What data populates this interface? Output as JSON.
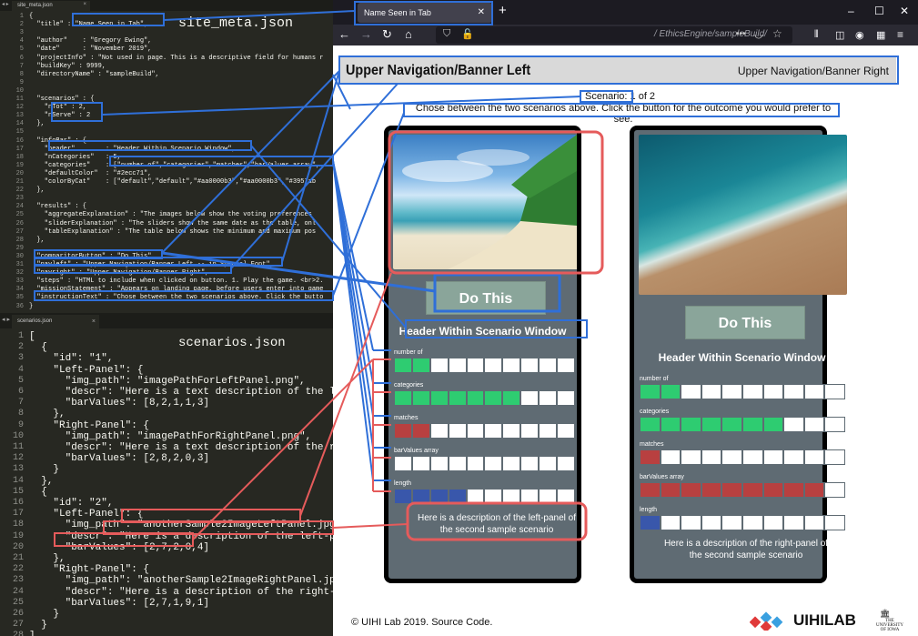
{
  "editor_top": {
    "tab_label": "site_meta.json",
    "heading": "site_meta.json",
    "lines": [
      {
        "n": "1",
        "t": "{"
      },
      {
        "n": "2",
        "t": "  \"title\" : \"Name Seen in Tab\","
      },
      {
        "n": "3",
        "t": ""
      },
      {
        "n": "4",
        "t": "  \"author\"    : \"Gregory Ewing\","
      },
      {
        "n": "5",
        "t": "  \"date\"      : \"November 2019\","
      },
      {
        "n": "6",
        "t": "  \"projectInfo\" : \"Not used in page. This is a descriptive field for humans r"
      },
      {
        "n": "7",
        "t": "  \"buildKey\" : 9999,"
      },
      {
        "n": "8",
        "t": "  \"directoryName\" : \"sampleBuild\","
      },
      {
        "n": "9",
        "t": ""
      },
      {
        "n": "10",
        "t": ""
      },
      {
        "n": "11",
        "t": "  \"scenarios\" : {"
      },
      {
        "n": "12",
        "t": "    \"nTot\" : 2,"
      },
      {
        "n": "13",
        "t": "    \"nServe\" : 2"
      },
      {
        "n": "14",
        "t": "  },"
      },
      {
        "n": "15",
        "t": ""
      },
      {
        "n": "16",
        "t": "  \"infoBar\" : {"
      },
      {
        "n": "17",
        "t": "    \"header\"        : \"Header Within Scenario Window\","
      },
      {
        "n": "18",
        "t": "    \"nCategories\"   : 5,"
      },
      {
        "n": "19",
        "t": "    \"categories\"    : [\"number of\",\"categories\",\"matches\",\"barValues array\","
      },
      {
        "n": "20",
        "t": "    \"defaultColor\"  : \"#2ecc71\","
      },
      {
        "n": "21",
        "t": "    \"colorByCat\"    : [\"default\",\"default\",\"#aa0000b3\",\"#aa0000b3\",\"#3957ab"
      },
      {
        "n": "22",
        "t": "  },"
      },
      {
        "n": "23",
        "t": ""
      },
      {
        "n": "24",
        "t": "  \"results\" : {"
      },
      {
        "n": "25",
        "t": "    \"aggregateExplanation\" : \"The images below show the voting preferences"
      },
      {
        "n": "26",
        "t": "    \"sliderExplanation\" : \"The sliders show the same date as the table, onl"
      },
      {
        "n": "27",
        "t": "    \"tableExplanation\" : \"The table below shows the minimum and maximum pos"
      },
      {
        "n": "28",
        "t": "  },"
      },
      {
        "n": "29",
        "t": ""
      },
      {
        "n": "30",
        "t": "  \"comparitorButton\" : \"Do This\","
      },
      {
        "n": "31",
        "t": "  \"navleft\" : \"Upper Navigation/Banner Left -- in Special Font\","
      },
      {
        "n": "32",
        "t": "  \"navright\" : \"Upper Navigation/Banner Right\","
      },
      {
        "n": "33",
        "t": "  \"steps\" : \"HTML to include when clicked on button. 1. Play the game. <br>2."
      },
      {
        "n": "34",
        "t": "  \"missionStatement\" : \"Appears on landing page, before users enter into game"
      },
      {
        "n": "35",
        "t": "  \"instructionText\" : \"Chose between the two scenarios above. Click the butto"
      },
      {
        "n": "36",
        "t": "}"
      }
    ]
  },
  "editor_bottom": {
    "tab_label": "scenarios.json",
    "heading": "scenarios.json",
    "lines": [
      {
        "n": "1",
        "t": "["
      },
      {
        "n": "2",
        "t": "  {"
      },
      {
        "n": "3",
        "t": "    \"id\": \"1\","
      },
      {
        "n": "4",
        "t": "    \"Left-Panel\": {"
      },
      {
        "n": "5",
        "t": "      \"img_path\": \"imagePathForLeftPanel.png\","
      },
      {
        "n": "6",
        "t": "      \"descr\": \"Here is a text description of the left-pane"
      },
      {
        "n": "7",
        "t": "      \"barValues\": [8,2,1,1,3]"
      },
      {
        "n": "8",
        "t": "    },"
      },
      {
        "n": "9",
        "t": "    \"Right-Panel\": {"
      },
      {
        "n": "10",
        "t": "      \"img_path\": \"imagePathForRightPanel.png\","
      },
      {
        "n": "11",
        "t": "      \"descr\": \"Here is a text description of the right-pa"
      },
      {
        "n": "12",
        "t": "      \"barValues\": [2,8,2,0,3]"
      },
      {
        "n": "13",
        "t": "    }"
      },
      {
        "n": "14",
        "t": "  },"
      },
      {
        "n": "15",
        "t": "  {"
      },
      {
        "n": "16",
        "t": "    \"id\": \"2\","
      },
      {
        "n": "17",
        "t": "    \"Left-Panel\": {"
      },
      {
        "n": "18",
        "t": "      \"img_path\": \"anotherSample2ImageLeftPanel.jpg\","
      },
      {
        "n": "19",
        "t": "      \"descr\": \"Here is a description of the left-panel of"
      },
      {
        "n": "20",
        "t": "      \"barValues\": [2,7,2,0,4]"
      },
      {
        "n": "21",
        "t": "    },"
      },
      {
        "n": "22",
        "t": "    \"Right-Panel\": {"
      },
      {
        "n": "23",
        "t": "      \"img_path\": \"anotherSample2ImageRightPanel.jpg\","
      },
      {
        "n": "24",
        "t": "      \"descr\": \"Here is a description of the right-panel of"
      },
      {
        "n": "25",
        "t": "      \"barValues\": [2,7,1,9,1]"
      },
      {
        "n": "26",
        "t": "    }"
      },
      {
        "n": "27",
        "t": "  }"
      },
      {
        "n": "28",
        "t": "]"
      }
    ]
  },
  "browser": {
    "tab_title": "Name Seen in Tab",
    "tab_close": "✕",
    "new_tab": "+",
    "url": "/ EthicsEngine/sampleBuild/",
    "url_more": "•••",
    "win_min": "–",
    "win_max": "☐",
    "win_close": "✕"
  },
  "page": {
    "banner_left": "Upper Navigation/Banner Left",
    "banner_right": "Upper Navigation/Banner Right",
    "scenario_count": "Scenario: 1 of 2",
    "instruction": "Chose between the two scenarios above. Click the button for the outcome you would prefer to see.",
    "footer": "© UIHI Lab 2019. Source Code.",
    "logo_text": "UIHILAB",
    "uni_text_1": "THE",
    "uni_text_2": "UNIVERSITY",
    "uni_text_3": "OF IOWA"
  },
  "panels": [
    {
      "button": "Do This",
      "header": "Header Within Scenario Window",
      "description": "Here is a description of the left-panel of the second sample scenario",
      "bars": [
        {
          "label": "number of",
          "value": 2,
          "color": "#2ecc71"
        },
        {
          "label": "categories",
          "value": 7,
          "color": "#2ecc71"
        },
        {
          "label": "matches",
          "value": 2,
          "color": "#b84040"
        },
        {
          "label": "barValues array",
          "value": 0,
          "color": "#b84040"
        },
        {
          "label": "length",
          "value": 4,
          "color": "#3957ab"
        }
      ]
    },
    {
      "button": "Do This",
      "header": "Header Within Scenario Window",
      "description": "Here is a description of the right-panel of the second sample scenario",
      "bars": [
        {
          "label": "number of",
          "value": 2,
          "color": "#2ecc71"
        },
        {
          "label": "categories",
          "value": 7,
          "color": "#2ecc71"
        },
        {
          "label": "matches",
          "value": 1,
          "color": "#b84040"
        },
        {
          "label": "barValues array",
          "value": 9,
          "color": "#b84040"
        },
        {
          "label": "length",
          "value": 1,
          "color": "#3957ab"
        }
      ]
    }
  ],
  "colors": {
    "annotation_blue": "#2f6fd8",
    "annotation_red": "#e55b5b"
  }
}
